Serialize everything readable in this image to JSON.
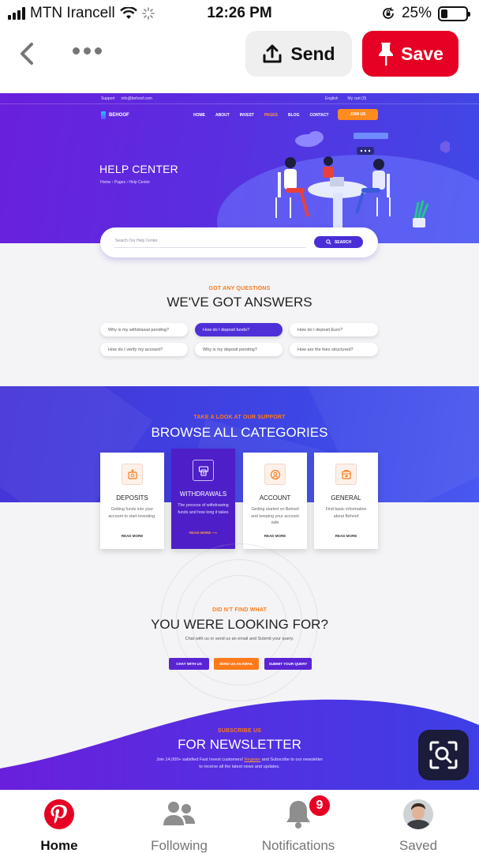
{
  "status_bar": {
    "carrier": "MTN Irancell",
    "time": "12:26 PM",
    "battery_percent": "25%",
    "battery_level": 0.25
  },
  "toolbar": {
    "send_label": "Send",
    "save_label": "Save"
  },
  "pin": {
    "utility": {
      "support": "Support",
      "email": "info@behoof.com",
      "language": "English",
      "cart": "My cart (0)"
    },
    "brand": "BEHOOF",
    "menu": [
      "HOME",
      "ABOUT",
      "INVEST",
      "PAGES",
      "BLOG",
      "CONTACT"
    ],
    "active_menu": "PAGES",
    "join_label": "JOIN US",
    "hero_title": "HELP CENTER",
    "breadcrumb": "Home  ›  Pages  ›  Help Center",
    "search": {
      "placeholder": "Search Our Help Center",
      "button": "SEARCH"
    },
    "faq_section": {
      "kicker": "GOT ANY QUESTIONS",
      "title": "WE'VE GOT ANSWERS",
      "questions": [
        "Why is my withdrawal pending?",
        "How do I deposit funds?",
        "How do I deposit Euro?",
        "How do I verify my account?",
        "Why is my deposit pending?",
        "How are the fees structured?"
      ]
    },
    "categories_section": {
      "kicker": "TAKE A LOOK AT OUR SUPPORT",
      "title": "BROWSE ALL CATEGORIES",
      "cards": [
        {
          "title": "DEPOSITS",
          "desc": "Getting funds into your account to start investing.",
          "link": "READ MORE"
        },
        {
          "title": "WITHDRAWALS",
          "desc": "The process of withdrawing funds and how long it takes",
          "link": "READ MORE  ⟶"
        },
        {
          "title": "ACCOUNT",
          "desc": "Getting started on Behoof and keeping your account safe",
          "link": "READ MORE"
        },
        {
          "title": "GENERAL",
          "desc": "Find basic information about Behoof",
          "link": "READ MORE"
        }
      ]
    },
    "contact_section": {
      "kicker": "DID N'T FIND WHAT",
      "title": "YOU WERE LOOKING FOR?",
      "subtitle": "Chat with us or send us an email and Submit your query.",
      "buttons": [
        "CHAT WITH US",
        "SEND US AN EMAIL",
        "SUBMIT YOUR QUERY"
      ]
    },
    "newsletter_section": {
      "kicker": "SUBSCRIBE US",
      "title": "FOR NEWSLETTER",
      "line1_pre": "Join 14,000+ satisfied Fast Invest customers! ",
      "line1_link": "Register",
      "line1_post": " and Subscribe to our newsletter",
      "line2": "to receive all the latest news and updates."
    }
  },
  "tabs": [
    {
      "label": "Home",
      "icon": "pinterest-icon",
      "active": true
    },
    {
      "label": "Following",
      "icon": "people-icon",
      "active": false
    },
    {
      "label": "Notifications",
      "icon": "bell-icon",
      "active": false,
      "badge": "9"
    },
    {
      "label": "Saved",
      "icon": "avatar",
      "active": false
    }
  ],
  "colors": {
    "pinterest_red": "#e60023",
    "hero_purple": "#5a2ee0",
    "accent_orange": "#ff7a1a"
  }
}
